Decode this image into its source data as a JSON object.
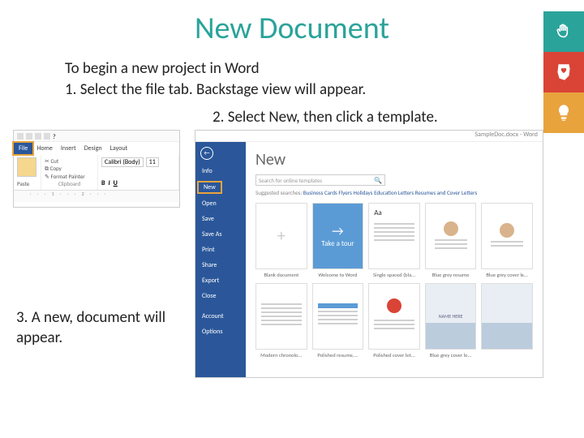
{
  "page_title": "New Document",
  "intro_line": "To begin a new project in Word",
  "step1": "1.  Select the file tab. Backstage view will appear.",
  "step2": "2.  Select New, then click a template.",
  "step3": "3.  A new, document will appear.",
  "sidebar_icons": [
    "hand-icon",
    "heart-ohio-icon",
    "lightbulb-icon"
  ],
  "shot1": {
    "tabs": {
      "file": "File",
      "home": "Home",
      "insert": "Insert",
      "design": "Design",
      "layout": "Layout"
    },
    "ribbon": {
      "paste": "Paste",
      "cut": "Cut",
      "copy": "Copy",
      "format_painter": "Format Painter",
      "clipboard_label": "Clipboard",
      "font": "Calibri (Body)",
      "size": "11"
    }
  },
  "shot2": {
    "window_title": "SampleDoc.docx - Word",
    "nav": {
      "info": "Info",
      "new": "New",
      "open": "Open",
      "save": "Save",
      "save_as": "Save As",
      "print": "Print",
      "share": "Share",
      "export": "Export",
      "close": "Close",
      "account": "Account",
      "options": "Options"
    },
    "heading": "New",
    "search_placeholder": "Search for online templates",
    "suggested_label": "Suggested searches:",
    "suggested": [
      "Business",
      "Cards",
      "Flyers",
      "Holidays",
      "Education",
      "Letters",
      "Resumes and Cover Letters"
    ],
    "templates": [
      {
        "label": "Blank document"
      },
      {
        "label": "Welcome to Word",
        "tour_text": "Take a tour"
      },
      {
        "label": "Single spaced (bla..."
      },
      {
        "label": "Blue grey resume"
      },
      {
        "label": "Blue grey cover le..."
      },
      {
        "label": "Modern chronolo..."
      },
      {
        "label": "Polished resume,..."
      },
      {
        "label": "Polished cover let..."
      },
      {
        "label": "Blue grey cover le...",
        "name_text": "NAME HERE"
      },
      {
        "label": ""
      }
    ]
  }
}
